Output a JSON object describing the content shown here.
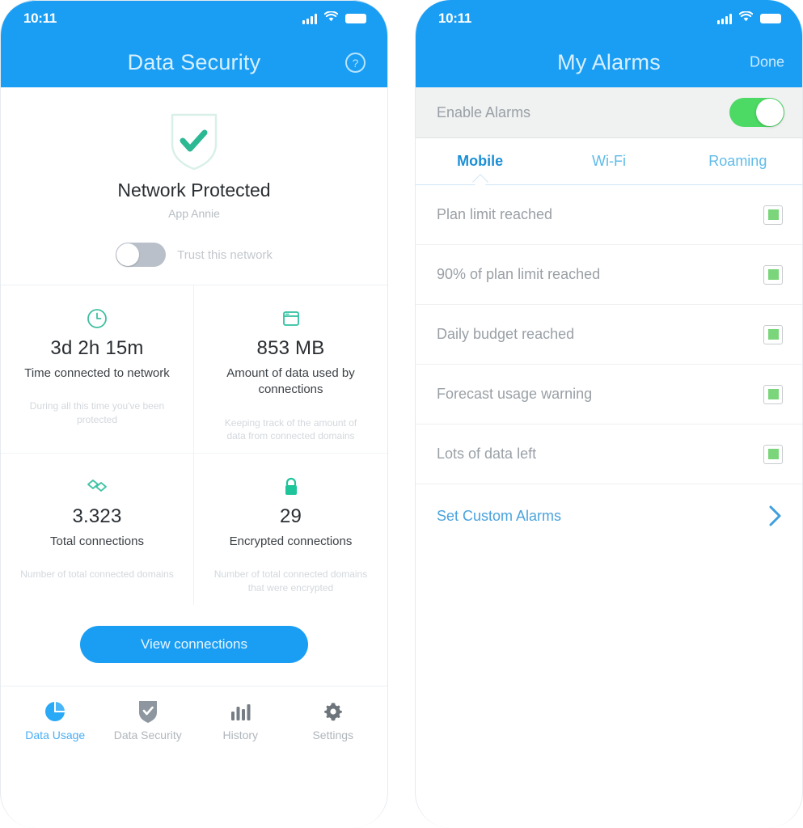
{
  "left_phone": {
    "statusbar": {
      "time": "10:11",
      "signal_icon": "cellular-signal-icon",
      "wifi_icon": "wifi-icon",
      "battery_icon": "battery-full-icon"
    },
    "navbar": {
      "title": "Data Security",
      "help_icon": "help-circle-icon"
    },
    "hero": {
      "shield_icon": "shield-check-icon",
      "title": "Network Protected",
      "subtitle": "App Annie",
      "trust_toggle_label": "Trust this network",
      "trust_toggle_state": "off"
    },
    "stats": [
      {
        "icon": "clock-icon",
        "value": "3d 2h 15m",
        "label": "Time connected to network",
        "note": "During all this time you've been protected"
      },
      {
        "icon": "browser-window-icon",
        "value": "853 MB",
        "label": "Amount of data used by connections",
        "note": "Keeping track of the amount of data from connected domains"
      },
      {
        "icon": "connections-icon",
        "value": "3.323",
        "label": "Total connections",
        "note": "Number of total connected domains"
      },
      {
        "icon": "lock-icon",
        "value": "29",
        "label": "Encrypted connections",
        "note": "Number of total connected domains that were encrypted"
      }
    ],
    "cta": {
      "label": "View connections"
    },
    "tabbar": [
      {
        "icon": "pie-chart-icon",
        "label": "Data Usage",
        "active": true
      },
      {
        "icon": "shield-check-icon",
        "label": "Data Security",
        "active": false
      },
      {
        "icon": "bar-chart-icon",
        "label": "History",
        "active": false
      },
      {
        "icon": "gear-icon",
        "label": "Settings",
        "active": false
      }
    ]
  },
  "right_phone": {
    "statusbar": {
      "time": "10:11",
      "signal_icon": "cellular-signal-icon",
      "wifi_icon": "wifi-icon",
      "battery_icon": "battery-full-icon"
    },
    "navbar": {
      "title": "My Alarms",
      "done_label": "Done"
    },
    "enable": {
      "label": "Enable Alarms",
      "state": "on"
    },
    "tabs": [
      {
        "label": "Mobile",
        "active": true
      },
      {
        "label": "Wi-Fi",
        "active": false
      },
      {
        "label": "Roaming",
        "active": false
      }
    ],
    "alarms": [
      {
        "label": "Plan limit reached",
        "checked": true
      },
      {
        "label": "90% of plan limit reached",
        "checked": true
      },
      {
        "label": "Daily budget reached",
        "checked": true
      },
      {
        "label": "Forecast usage warning",
        "checked": true
      },
      {
        "label": "Lots of data left",
        "checked": true
      }
    ],
    "custom": {
      "label": "Set Custom Alarms",
      "chevron_icon": "chevron-right-icon"
    }
  },
  "colors": {
    "brand_blue": "#1a9ef4",
    "title_blue": "#d7f0ff",
    "green_accent": "#35bf9a",
    "toggle_green": "#4cd964",
    "checkbox_green": "#7bd67b",
    "link_blue": "#4ba3dd",
    "muted_text": "#9aa0a6",
    "faint_text": "#d3d8dd"
  }
}
